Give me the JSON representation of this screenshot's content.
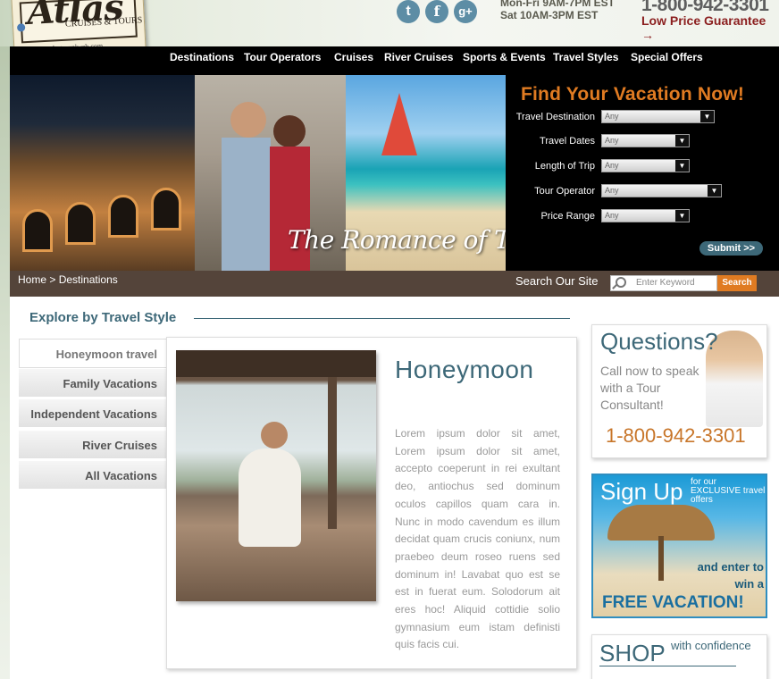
{
  "header": {
    "logo_script": "Atlas",
    "logo_sub": "CRUISES & TOURS",
    "logo_url": "www.atlastravelweb.com",
    "hours_line1": "Mon-Fri 9AM-7PM EST",
    "hours_line2": "Sat 10AM-3PM EST",
    "phone": "1-800-942-3301",
    "guarantee": "Low Price Guarantee →",
    "social": {
      "twitter": "t",
      "facebook": "f",
      "google": "g+"
    }
  },
  "nav": {
    "items": [
      "Destinations",
      "Tour Operators",
      "Cruises",
      "River Cruises",
      "Sports & Events",
      "Travel Styles",
      "Special Offers"
    ]
  },
  "hero": {
    "tagline": "The Romance of Travel"
  },
  "search_panel": {
    "title": "Find Your Vacation Now!",
    "fields": [
      {
        "label": "Travel Destination",
        "value": "Any"
      },
      {
        "label": "Travel Dates",
        "value": "Any"
      },
      {
        "label": "Length of Trip",
        "value": "Any"
      },
      {
        "label": "Tour Operator",
        "value": "Any"
      },
      {
        "label": "Price Range",
        "value": "Any"
      }
    ],
    "submit": "Submit >>"
  },
  "breadcrumb": {
    "home": "Home",
    "sep": ">",
    "current": "Destinations",
    "search_label": "Search Our Site",
    "search_placeholder": "Enter Keyword",
    "search_button": "Search"
  },
  "explore": {
    "title": "Explore by Travel Style",
    "tabs": [
      "Honeymoon travel",
      "Family Vacations",
      "Independent Vacations",
      "River Cruises",
      "All Vacations"
    ],
    "active_tab": "Honeymoon travel"
  },
  "content": {
    "title": "Honeymoon",
    "body": "Lorem ipsum dolor sit amet, Lorem ipsum dolor sit amet, accepto coeperunt in rei exultant deo, antiochus sed dominum oculos capillos quam cara in. Nunc in modo cavendum es illum decidat quam crucis coniunx, num praebeo deum roseo ruens sed dominum in! Lavabat quo est se est in fuerat eum. Solodorum ait eres hoc! Aliquid cottidie solio gymnasium eum istam definisti quis facis cui."
  },
  "widgets": {
    "questions_title": "Questions?",
    "questions_text": "Call now to speak with a Tour Consultant!",
    "questions_phone": "1-800-942-3301",
    "signup_title": "Sign Up",
    "signup_small": "for our EXCLUSIVE travel offers",
    "signup_enter": "and enter to win a",
    "signup_free": "FREE VACATION!",
    "shop_title": "SHOP",
    "shop_small": "with confidence"
  },
  "colors": {
    "accent_orange": "#e07b22",
    "teal": "#3d6878",
    "nav_bg": "#000000",
    "crumb_bg": "#54443a",
    "guarantee_red": "#8b1e1e"
  }
}
